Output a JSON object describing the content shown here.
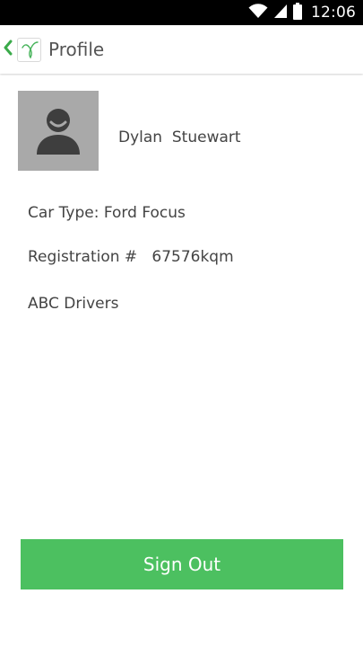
{
  "status_bar": {
    "time": "12:06",
    "icons": [
      "wifi-icon",
      "signal-icon",
      "battery-icon"
    ]
  },
  "header": {
    "title": "Profile",
    "back_icon": "chevron-left-icon",
    "logo_icon": "app-logo-icon"
  },
  "profile": {
    "avatar_icon": "person-avatar-icon",
    "name": "Dylan  Stuewart",
    "car_type": "Car Type: Ford Focus",
    "registration": "Registration #   67576kqm",
    "company": "ABC Drivers"
  },
  "actions": {
    "sign_out_label": "Sign Out"
  },
  "colors": {
    "accent": "#4cc060",
    "avatar_bg": "#a9a9a9",
    "status_bar_bg": "#000000",
    "text": "#444444"
  }
}
